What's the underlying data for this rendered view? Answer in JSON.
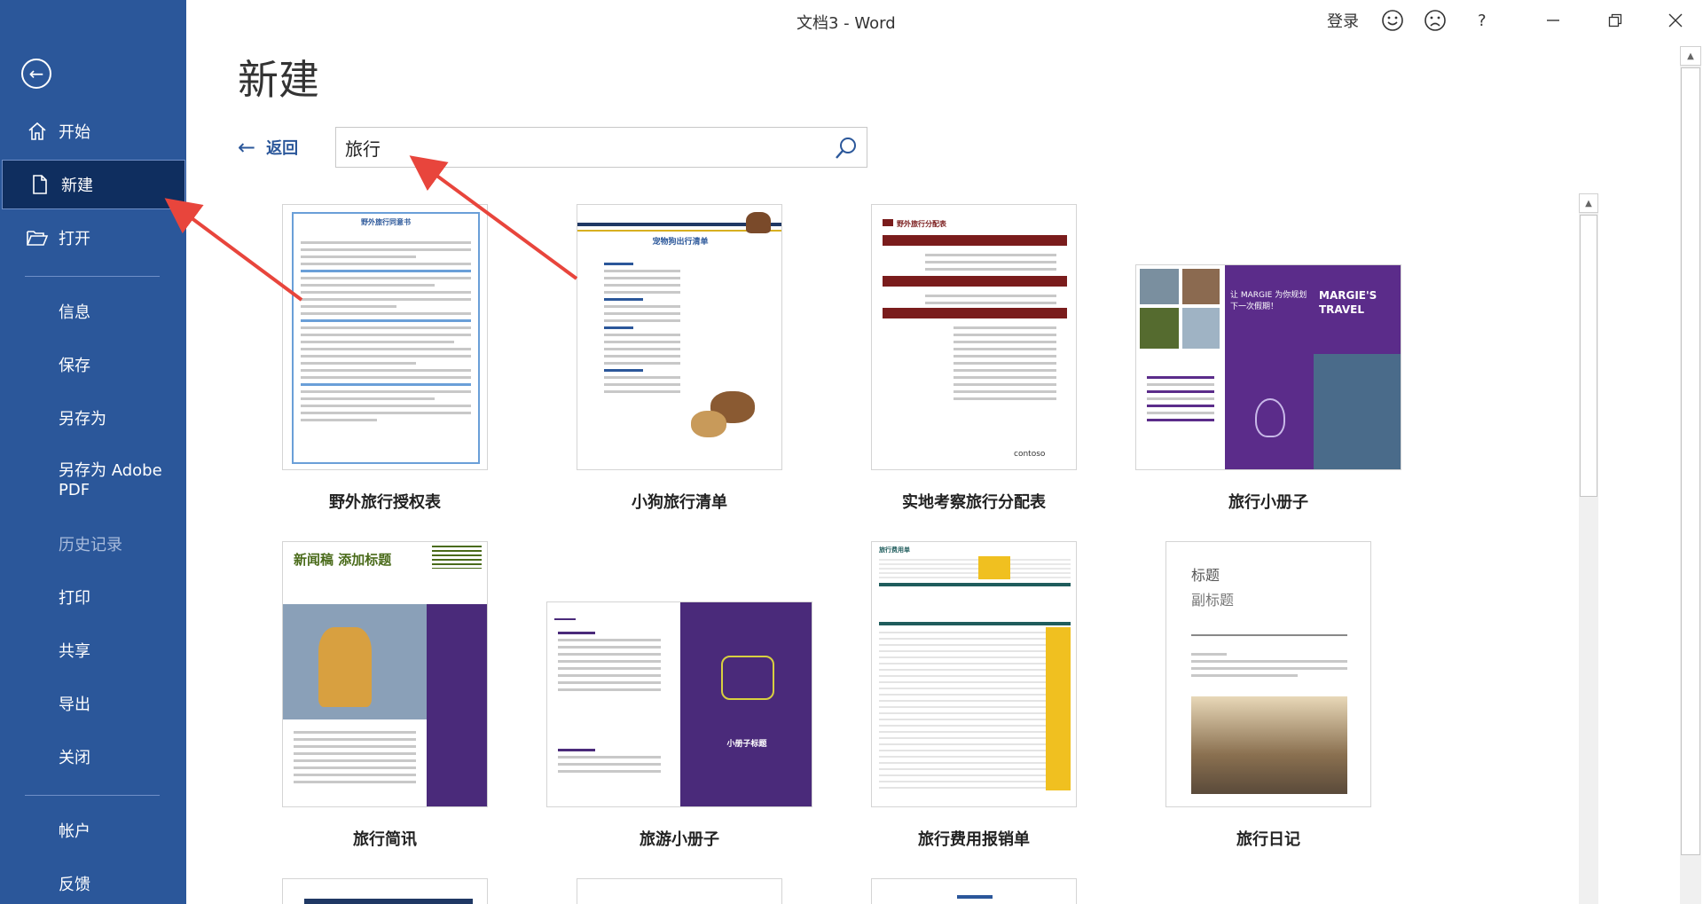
{
  "window": {
    "title": "文档3  -  Word",
    "signin_label": "登录",
    "help_label": "?",
    "minimize_label": "—",
    "restore_label": "❐",
    "close_label": "✕"
  },
  "sidebar": {
    "back_label": "←",
    "items": [
      {
        "label": "开始"
      },
      {
        "label": "新建"
      },
      {
        "label": "打开"
      },
      {
        "label": "信息"
      },
      {
        "label": "保存"
      },
      {
        "label": "另存为"
      },
      {
        "label": "另存为 Adobe PDF"
      },
      {
        "label": "历史记录"
      },
      {
        "label": "打印"
      },
      {
        "label": "共享"
      },
      {
        "label": "导出"
      },
      {
        "label": "关闭"
      },
      {
        "label": "帐户"
      },
      {
        "label": "反馈"
      }
    ]
  },
  "main": {
    "page_title": "新建",
    "return_label": "返回",
    "search_value": "旅行"
  },
  "templates": [
    {
      "label": "野外旅行授权表",
      "thumb_title": "野外旅行同意书"
    },
    {
      "label": "小狗旅行清单",
      "thumb_title": "宠物狗出行清单"
    },
    {
      "label": "实地考察旅行分配表",
      "thumb_title": "野外旅行分配表"
    },
    {
      "label": "旅行小册子",
      "thumb_title": "让 MARGIE 为你规划下一次假期！",
      "thumb_brand": "MARGIE'S TRAVEL"
    },
    {
      "label": "旅行简讯",
      "thumb_title": "新闻稿 添加标题"
    },
    {
      "label": "旅游小册子",
      "thumb_title": "小册子标题"
    },
    {
      "label": "旅行费用报销单",
      "thumb_title": "旅行费用单"
    },
    {
      "label": "旅行日记",
      "thumb_title": "标题",
      "thumb_subtitle": "副标题"
    }
  ],
  "colors": {
    "sidebar": "#2b579a",
    "active": "#0f2e5f",
    "annotation": "#e8453c"
  }
}
